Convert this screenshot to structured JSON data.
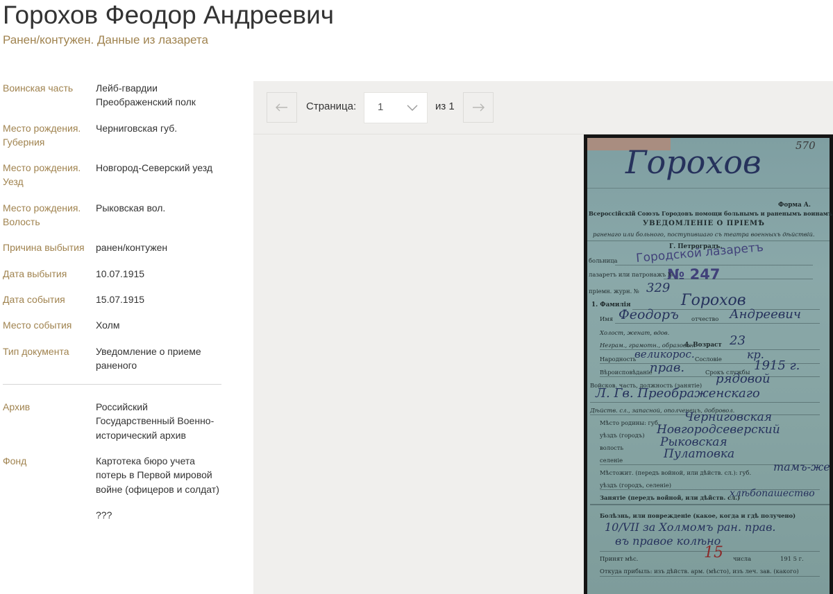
{
  "header": {
    "title": "Горохов Феодор Андреевич",
    "subtitle": "Ранен/контужен. Данные из лазарета"
  },
  "details": [
    {
      "label": "Воинская часть",
      "value": "Лейб-гвардии Преображенский полк"
    },
    {
      "label": "Место рождения. Губерния",
      "value": "Черниговская губ."
    },
    {
      "label": "Место рождения. Уезд",
      "value": "Новгород-Северский уезд"
    },
    {
      "label": "Место рождения. Волость",
      "value": "Рыковская вол."
    },
    {
      "label": "Причина выбытия",
      "value": "ранен/контужен"
    },
    {
      "label": "Дата выбытия",
      "value": "10.07.1915"
    },
    {
      "label": "Дата события",
      "value": "15.07.1915"
    },
    {
      "label": "Место события",
      "value": "Холм"
    },
    {
      "label": "Тип документа",
      "value": "Уведомление о приеме раненого"
    }
  ],
  "archive": [
    {
      "label": "Архив",
      "value": "Российский Государственный Военно-исторический архив"
    },
    {
      "label": "Фонд",
      "value": "Картотека бюро учета потерь в Первой мировой войне (офицеров и солдат)"
    },
    {
      "label": "",
      "value": "???"
    }
  ],
  "viewer": {
    "prev_icon": "arrow-left-icon",
    "next_icon": "arrow-right-icon",
    "page_label": "Страница:",
    "page_value": "1",
    "page_of": "из 1"
  },
  "document": {
    "surname_hw": "Горохов",
    "page_number": "570",
    "form_label": "Форма А.",
    "org": "Всероссійскій Союзъ Городовъ помощи больнымъ и раненымъ воинамъ.",
    "heading": "УВЕДОМЛЕНІЕ О ПРІЕМѢ",
    "subheading": "раненаго или больного, поступившаго съ театра военныхъ дѣйствій.",
    "city": "Г. Петроградъ.",
    "stamp_text": "Городской лазаретъ",
    "stamp_number": "№ 247",
    "lines": {
      "hospital": "больница",
      "lazaret": "лазаретъ или патронажъ №",
      "journal": "пріемн. журн. №",
      "journal_no": "329",
      "surname_label": "1. Фамилія",
      "surname_value": "Горохов",
      "name_label": "Имя",
      "name_value": "Феодоръ",
      "patronymic_label": "отчество",
      "patronymic_value": "Андреевич",
      "marital": "Холост, женат, вдов.",
      "literacy": "Неграм., грамотн., образован.",
      "age_label": "4. Возраст",
      "age_value": "23",
      "nationality_label": "Народность",
      "nationality_value": "великорос.",
      "estate_label": "Сословіе",
      "estate_value": "кр.",
      "religion_label": "Вѣроисповѣданіе",
      "religion_value": "прав.",
      "service_label": "Срокъ службы",
      "service_value": "1915 г.",
      "unit_label": "Войсков. часть, должность (занятіе)",
      "unit_value": "рядовой",
      "unit_value_2": "Л. Гв. Преображенскаго",
      "status": "Дѣйств. сл., запасной, ополченецъ, добровол.",
      "birthplace_label": "Мѣсто родины: губ.",
      "birthplace_value": "Черниговская",
      "uezd_label": "уѣздъ (городъ)",
      "uezd_value": "Новгородсеверский",
      "volost_label": "волость",
      "volost_value": "Рыковская",
      "village_label": "селеніе",
      "village_value": "Пулатовка",
      "residence_label": "Мѣстожит. (передъ войной, или дѣйств. сл.): губ.",
      "residence_value": "тамъ-же",
      "residence_uezd": "уѣздъ (городъ, селеніе)",
      "occupation_label": "Занятіе (передъ войной, или дѣйств. сл.)",
      "occupation_value": "хлѣбопашество",
      "illness_label": "Болѣзнь, или поврежденіе (какое, когда и гдѣ получено)",
      "illness_value": "10/VII за Холмомъ ран. прав.",
      "illness_value_2": "въ правое колѣно",
      "accepted_label": "Принят мѣс.",
      "accepted_day": "15",
      "accepted_num": "числа",
      "accepted_year": "191 5 г.",
      "from_label": "Откуда прибыль: изъ дѣйств. арм. (мѣсто), изъ леч. зав. (какого)"
    }
  },
  "colors": {
    "label": "#a0834f",
    "value": "#333333",
    "viewer_bg": "#f0efed",
    "ink": "#26325c"
  }
}
